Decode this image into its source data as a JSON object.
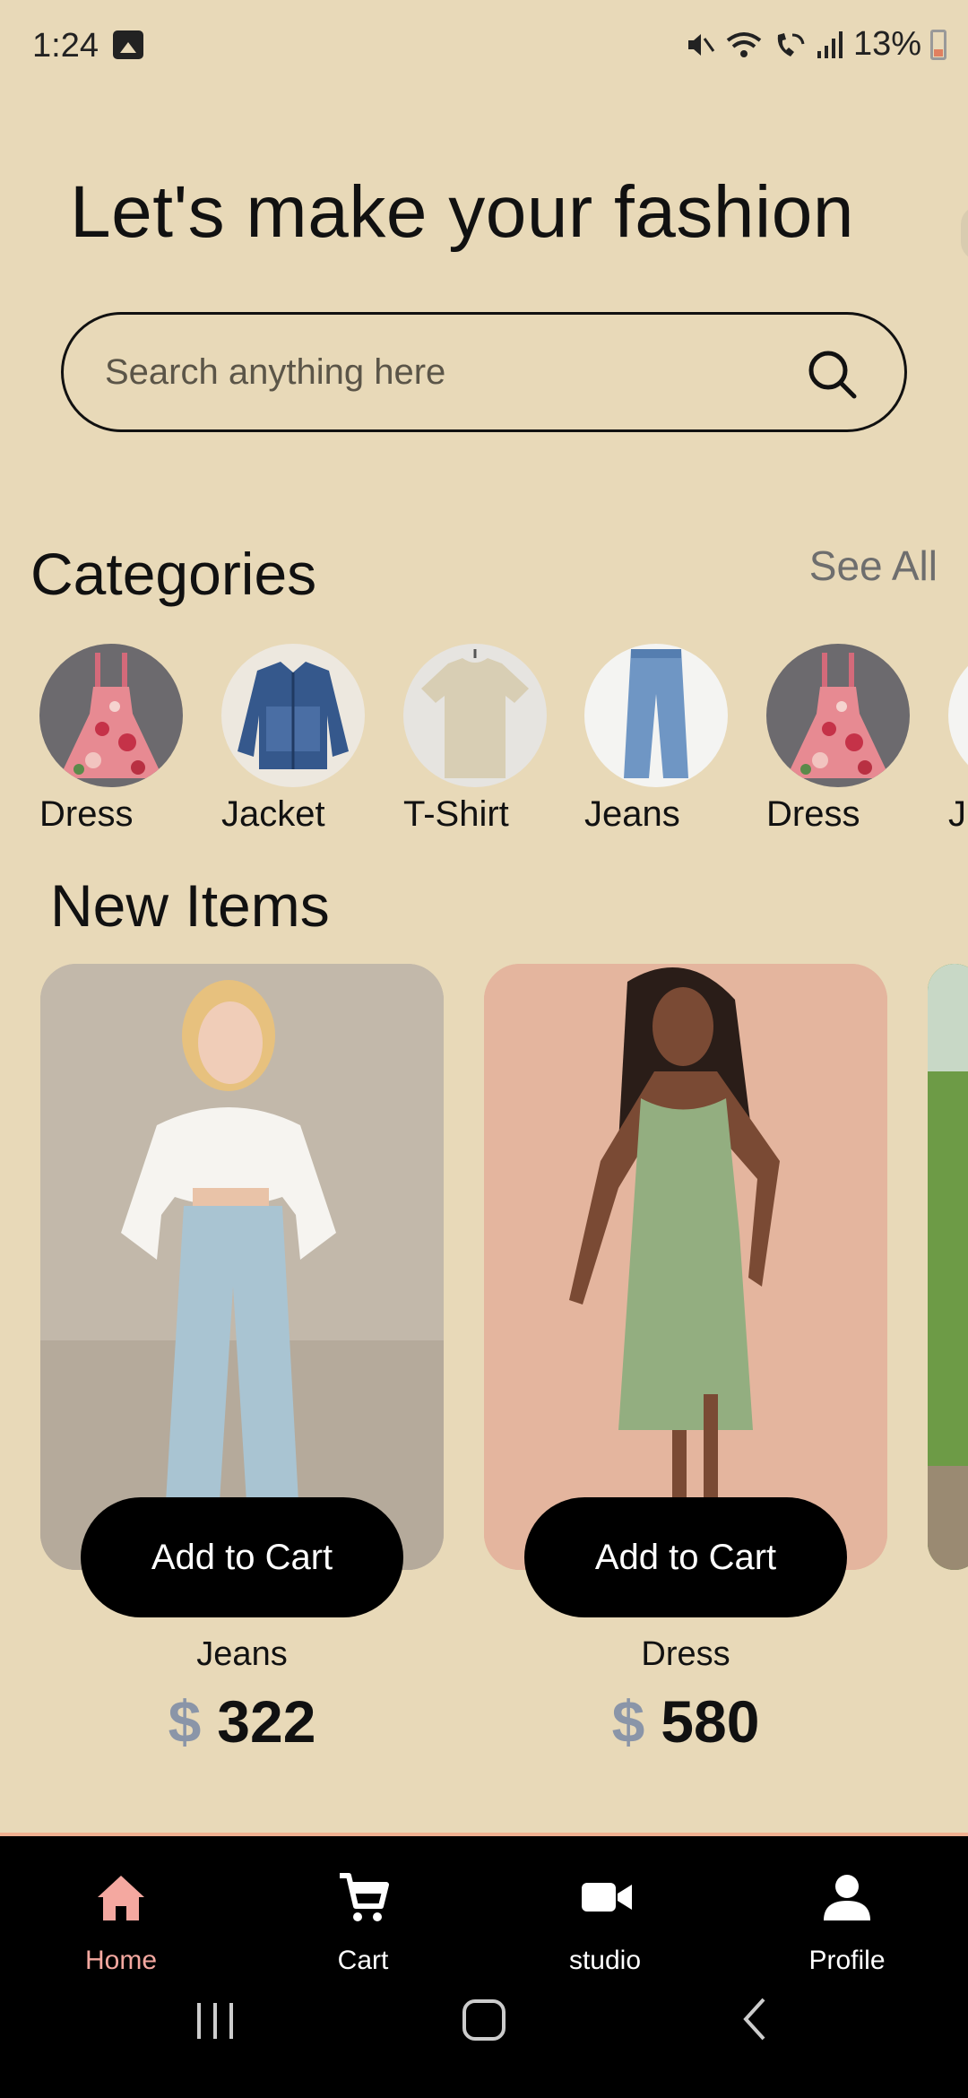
{
  "status": {
    "time": "1:24",
    "battery": "13%"
  },
  "headline": "Let's make your fashion",
  "search": {
    "placeholder": "Search anything here"
  },
  "categories": {
    "title": "Categories",
    "see_all": "See All",
    "items": [
      {
        "label": "Dress"
      },
      {
        "label": "Jacket"
      },
      {
        "label": "T-Shirt"
      },
      {
        "label": "Jeans"
      },
      {
        "label": "Dress"
      },
      {
        "label": "J"
      }
    ]
  },
  "new_items": {
    "title": "New Items",
    "cards": [
      {
        "name": "Jeans",
        "currency": "$",
        "price": "322",
        "button": "Add to Cart"
      },
      {
        "name": "Dress",
        "currency": "$",
        "price": "580",
        "button": "Add to Cart"
      }
    ]
  },
  "nav": {
    "items": [
      {
        "label": "Home",
        "icon": "home-icon"
      },
      {
        "label": "Cart",
        "icon": "cart-icon"
      },
      {
        "label": "studio",
        "icon": "video-icon"
      },
      {
        "label": "Profile",
        "icon": "profile-icon"
      }
    ],
    "active_color": "#f4a8a0"
  },
  "colors": {
    "background": "#e8d9b8",
    "nav_background": "#000000",
    "button": "#000000"
  }
}
